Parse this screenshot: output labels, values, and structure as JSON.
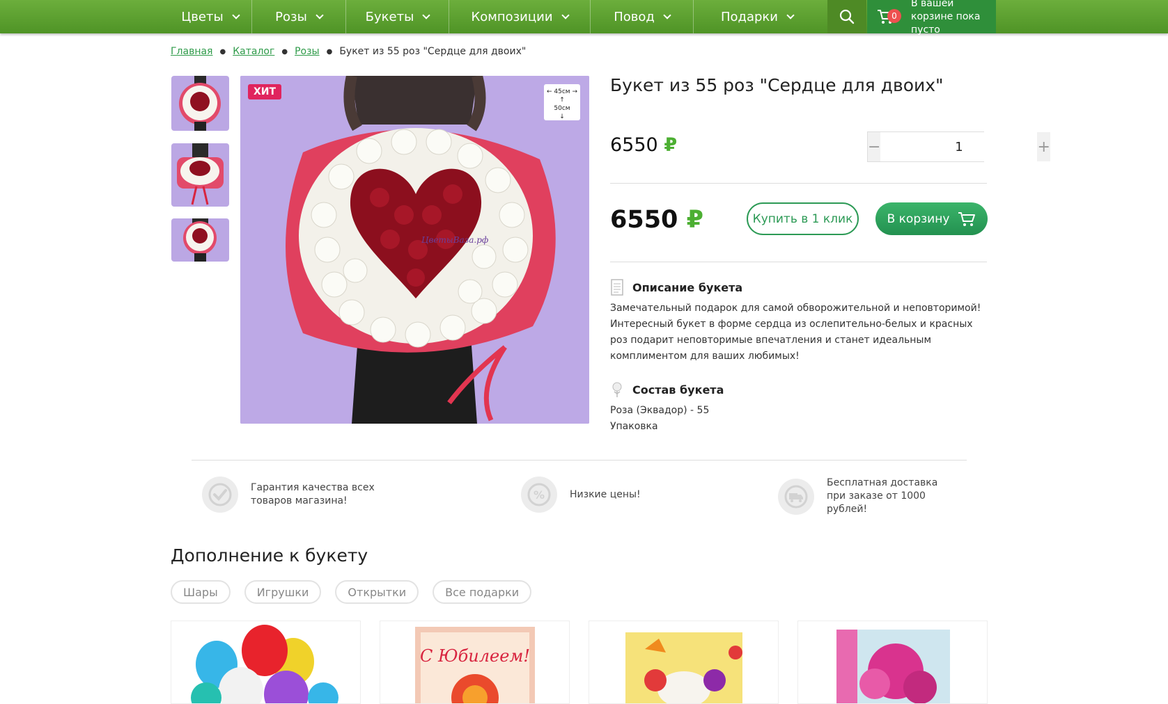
{
  "nav": {
    "items": [
      {
        "label": "Цветы"
      },
      {
        "label": "Розы"
      },
      {
        "label": "Букеты"
      },
      {
        "label": "Композиции"
      },
      {
        "label": "Повод"
      },
      {
        "label": "Подарки"
      }
    ]
  },
  "cart": {
    "count": "0",
    "text": "В вашей корзине пока пусто"
  },
  "breadcrumbs": {
    "home": "Главная",
    "catalog": "Каталог",
    "roses": "Розы",
    "current": "Букет из 55 роз \"Сердце для двоих\""
  },
  "product": {
    "badge": "ХИТ",
    "size_width": "45см",
    "size_height": "50см",
    "watermark": "ЦветыВаза.рф",
    "title": "Букет из 55 роз \"Сердце для двоих\"",
    "price": "6550",
    "currency": "₽",
    "quantity": "1",
    "buy_one_click": "Купить в 1 клик",
    "add_to_cart": "В корзину",
    "description_title": "Описание букета",
    "description_text": "Замечательный подарок для самой обворожительной и неповторимой!  Интересный букет в форме сердца из ослепительно-белых и красных роз подарит неповторимые впечатления и станет идеальным комплиментом для ваших любимых!",
    "composition_title": "Состав букета",
    "composition_line1": "Роза (Эквадор) - 55",
    "composition_line2": "Упаковка"
  },
  "advantages": [
    {
      "text": "Гарантия качества всех товаров магазина!",
      "icon": "check-badge-icon"
    },
    {
      "text": "Низкие цены!",
      "icon": "percent-badge-icon"
    },
    {
      "text": "Бесплатная доставка при заказе от 1000 рублей!",
      "icon": "truck-badge-icon"
    }
  ],
  "addons": {
    "title": "Дополнение к букету",
    "tabs": [
      "Шары",
      "Игрушки",
      "Открытки",
      "Все подарки"
    ],
    "card_greeting": "С Юбилеем!"
  },
  "colors": {
    "nav_green": "#5ba232",
    "accent_green": "#2c9a55",
    "ruble_green": "#4caf32",
    "hit_pink": "#e0245e"
  }
}
